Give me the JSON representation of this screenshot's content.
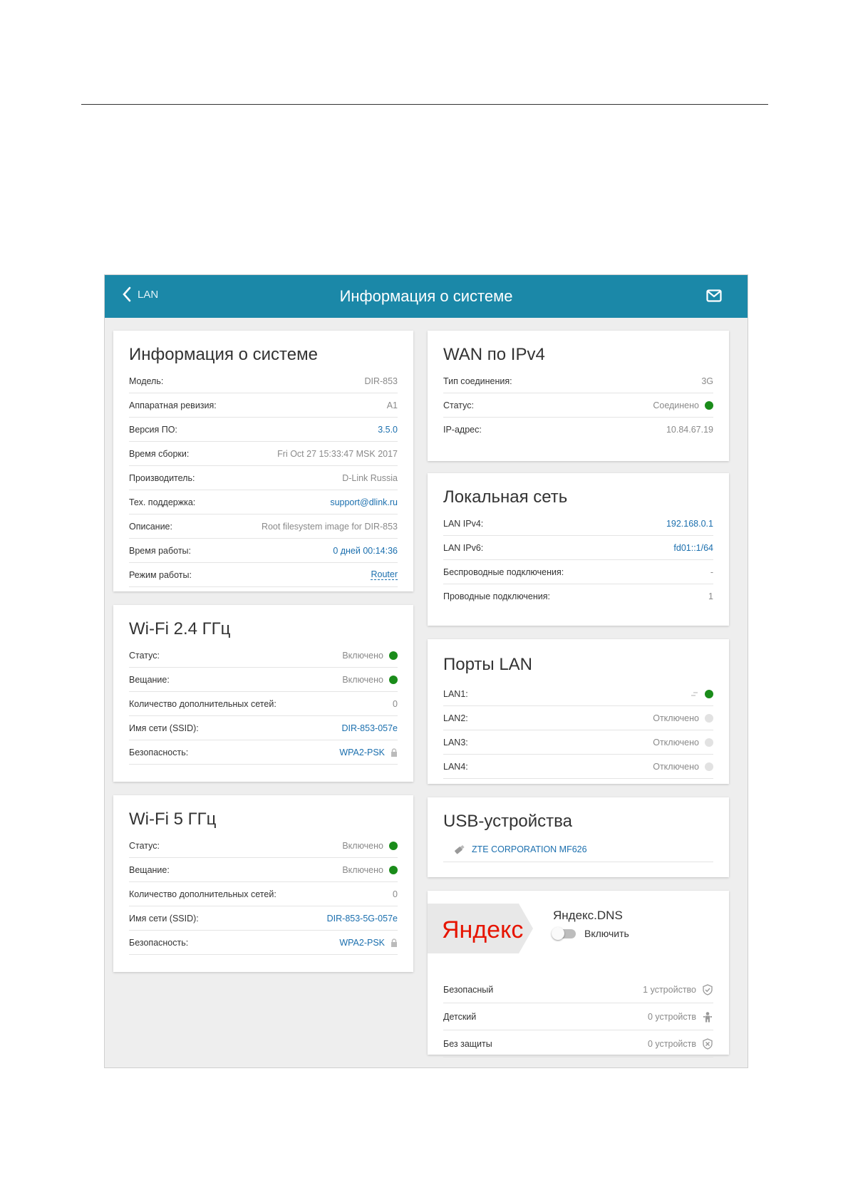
{
  "header": {
    "back_label": "LAN",
    "title": "Информация о системе"
  },
  "system": {
    "title": "Информация о системе",
    "rows": [
      {
        "label": "Модель:",
        "value": "DIR-853"
      },
      {
        "label": "Аппаратная ревизия:",
        "value": "A1"
      },
      {
        "label": "Версия ПО:",
        "value": "3.5.0"
      },
      {
        "label": "Время сборки:",
        "value": "Fri Oct 27 15:33:47 MSK 2017"
      },
      {
        "label": "Производитель:",
        "value": "D-Link Russia"
      },
      {
        "label": "Тех. поддержка:",
        "value": "support@dlink.ru"
      },
      {
        "label": "Описание:",
        "value": "Root filesystem image for DIR-853"
      },
      {
        "label": "Время работы:",
        "value": "0 дней 00:14:36"
      },
      {
        "label": "Режим работы:",
        "value": "Router"
      }
    ]
  },
  "wifi24": {
    "title": "Wi-Fi 2.4 ГГц",
    "rows": [
      {
        "label": "Статус:",
        "value": "Включено"
      },
      {
        "label": "Вещание:",
        "value": "Включено"
      },
      {
        "label": "Количество дополнительных сетей:",
        "value": "0"
      },
      {
        "label": "Имя сети (SSID):",
        "value": "DIR-853-057e"
      },
      {
        "label": "Безопасность:",
        "value": "WPA2-PSK"
      }
    ]
  },
  "wifi5": {
    "title": "Wi-Fi 5 ГГц",
    "rows": [
      {
        "label": "Статус:",
        "value": "Включено"
      },
      {
        "label": "Вещание:",
        "value": "Включено"
      },
      {
        "label": "Количество дополнительных сетей:",
        "value": "0"
      },
      {
        "label": "Имя сети (SSID):",
        "value": "DIR-853-5G-057e"
      },
      {
        "label": "Безопасность:",
        "value": "WPA2-PSK"
      }
    ]
  },
  "wan": {
    "title": "WAN по IPv4",
    "rows": [
      {
        "label": "Тип соединения:",
        "value": "3G"
      },
      {
        "label": "Статус:",
        "value": "Соединено"
      },
      {
        "label": "IP-адрес:",
        "value": "10.84.67.19"
      }
    ]
  },
  "lan": {
    "title": "Локальная сеть",
    "rows": [
      {
        "label": "LAN IPv4:",
        "value": "192.168.0.1"
      },
      {
        "label": "LAN IPv6:",
        "value": "fd01::1/64"
      },
      {
        "label": "Беспроводные подключения:",
        "value": "-"
      },
      {
        "label": "Проводные подключения:",
        "value": "1"
      }
    ]
  },
  "ports": {
    "title": "Порты LAN",
    "rows": [
      {
        "label": "LAN1:",
        "value": ""
      },
      {
        "label": "LAN2:",
        "value": "Отключено"
      },
      {
        "label": "LAN3:",
        "value": "Отключено"
      },
      {
        "label": "LAN4:",
        "value": "Отключено"
      }
    ]
  },
  "usb": {
    "title": "USB-устройства",
    "device": "ZTE CORPORATION MF626"
  },
  "yandex": {
    "logo_text": "Яндекс",
    "title": "Яндекс.DNS",
    "toggle_label": "Включить",
    "rows": [
      {
        "label": "Безопасный",
        "value": "1 устройство"
      },
      {
        "label": "Детский",
        "value": "0 устройств"
      },
      {
        "label": "Без защиты",
        "value": "0 устройств"
      }
    ]
  },
  "colors": {
    "header_bg": "#1b88a8",
    "link": "#1b6fae",
    "status_on": "#1a8c1a",
    "status_off": "#e2e2e2",
    "yandex_red": "#e61400"
  }
}
